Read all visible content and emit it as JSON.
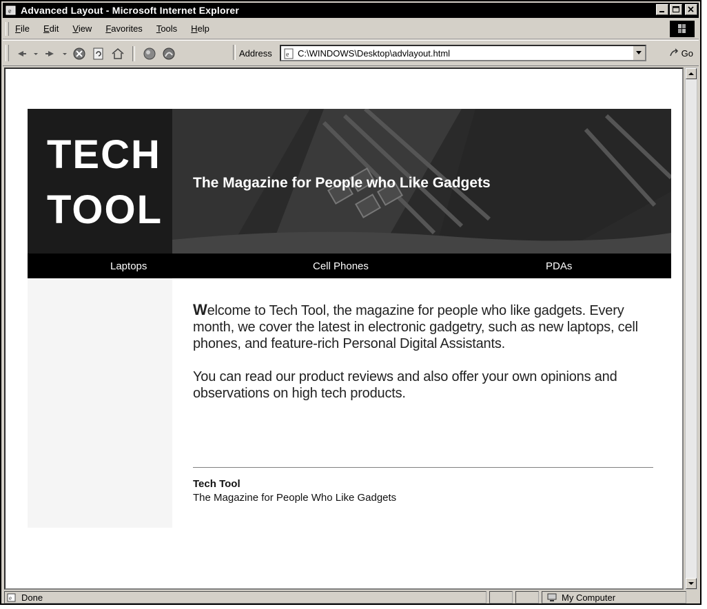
{
  "window": {
    "title": "Advanced Layout - Microsoft Internet Explorer",
    "accent_color": "#000000"
  },
  "menu": [
    "File",
    "Edit",
    "View",
    "Favorites",
    "Tools",
    "Help"
  ],
  "toolbar": {
    "buttons": [
      "back-icon",
      "forward-icon",
      "stop-icon",
      "refresh-icon",
      "home-icon",
      "search-icon",
      "favorites-icon"
    ],
    "address_label": "Address",
    "address_value": "C:\\WINDOWS\\Desktop\\advlayout.html",
    "go_label": "Go"
  },
  "page": {
    "logo_lines": [
      "TECH",
      "TOOL"
    ],
    "tagline": "The Magazine for People who Like Gadgets",
    "nav": [
      "Laptops",
      "Cell Phones",
      "PDAs"
    ],
    "welcome_first_letter": "W",
    "welcome_rest": "elcome to Tech Tool, the magazine for people who like gadgets. Every month, we cover the latest in electronic gadgetry, such as new laptops, cell phones, and feature-rich Personal Digital Assistants.",
    "paragraph2": "You can read our product reviews and also offer your own opinions and observations on high tech products.",
    "footer_title": "Tech Tool",
    "footer_subtitle": "The Magazine for People Who Like Gadgets",
    "banner_color": "#1b1b1b",
    "nav_color": "#000000"
  },
  "status": {
    "left_text": "Done",
    "zone_text": "My Computer"
  }
}
